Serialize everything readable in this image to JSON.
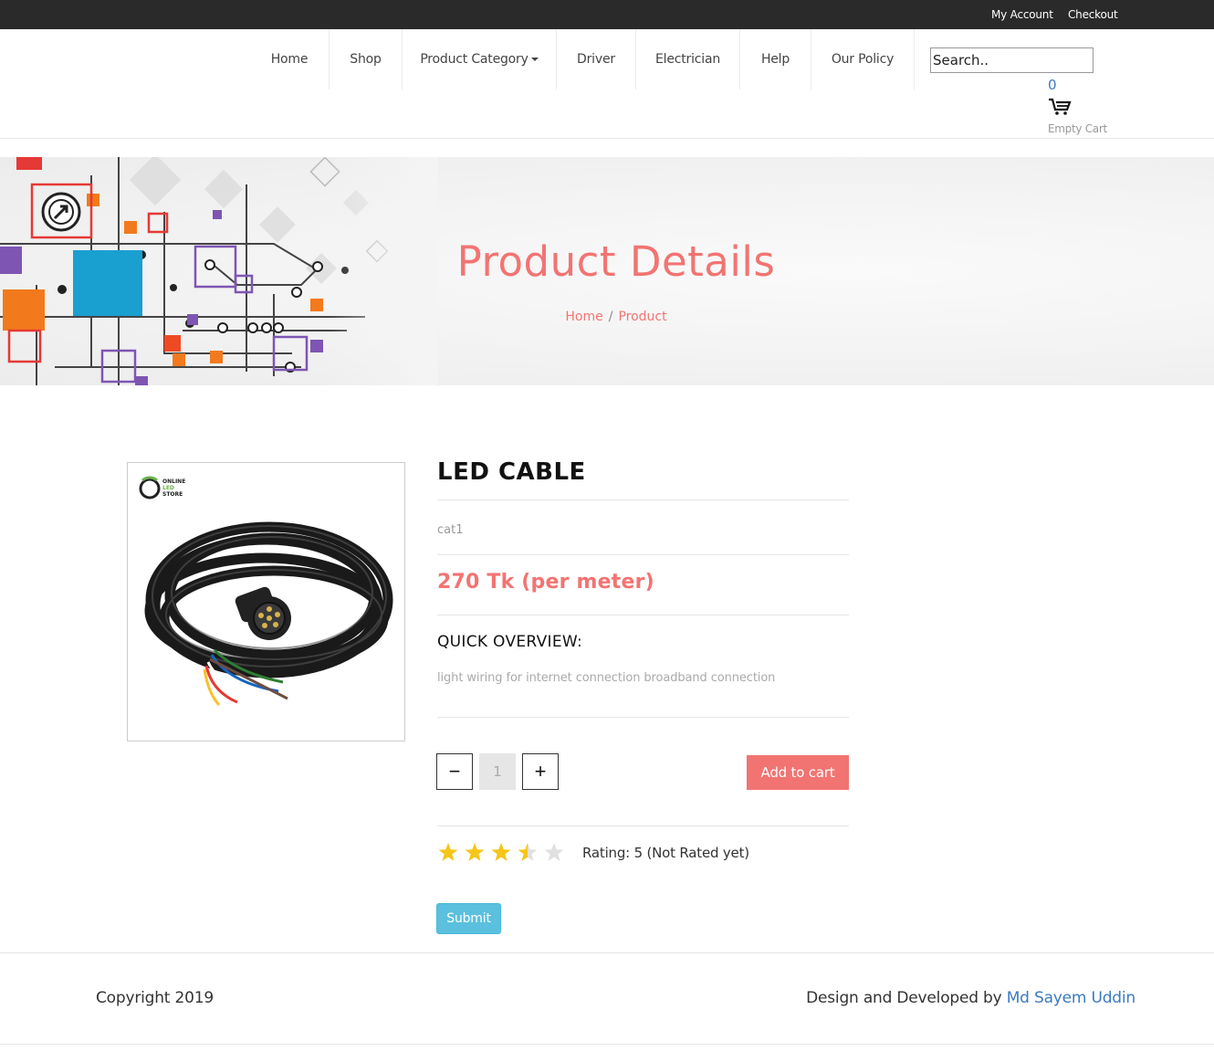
{
  "topbar": {
    "account": "My Account",
    "checkout": "Checkout"
  },
  "nav": {
    "items": [
      "Home",
      "Shop",
      "Product Category",
      "Driver",
      "Electrician",
      "Help",
      "Our Policy"
    ],
    "search_placeholder": "Search..",
    "cart_count": "0",
    "cart_label": "Empty Cart",
    "cart_icon": "shopping-cart-icon"
  },
  "banner": {
    "title": "Product Details",
    "breadcrumb": [
      "Home",
      "Product"
    ],
    "breadcrumb_sep": "/"
  },
  "product": {
    "name": "LED CABLE",
    "category": "cat1",
    "price": "270 Tk (per meter)",
    "overview_heading": "QUICK OVERVIEW:",
    "overview_text": "light wiring for internet connection broadband connection",
    "quantity": "1",
    "minus": "−",
    "plus": "+",
    "add_to_cart": "Add to cart",
    "image_logo_text": [
      "ONLINE",
      "LED",
      "STORE"
    ]
  },
  "rating": {
    "stars_filled": 3.5,
    "stars_total": 5,
    "star_color": "#f5c518",
    "text": "Rating: 5 (Not Rated yet)",
    "submit": "Submit"
  },
  "footer": {
    "copyright": "Copyright 2019",
    "credit_prefix": "Design and Developed by ",
    "credit_name": "Md Sayem Uddin"
  },
  "colors": {
    "accent": "#f27472",
    "link": "#3b7bbf",
    "submit": "#5bc0de",
    "topbar": "#2a2a2a"
  }
}
